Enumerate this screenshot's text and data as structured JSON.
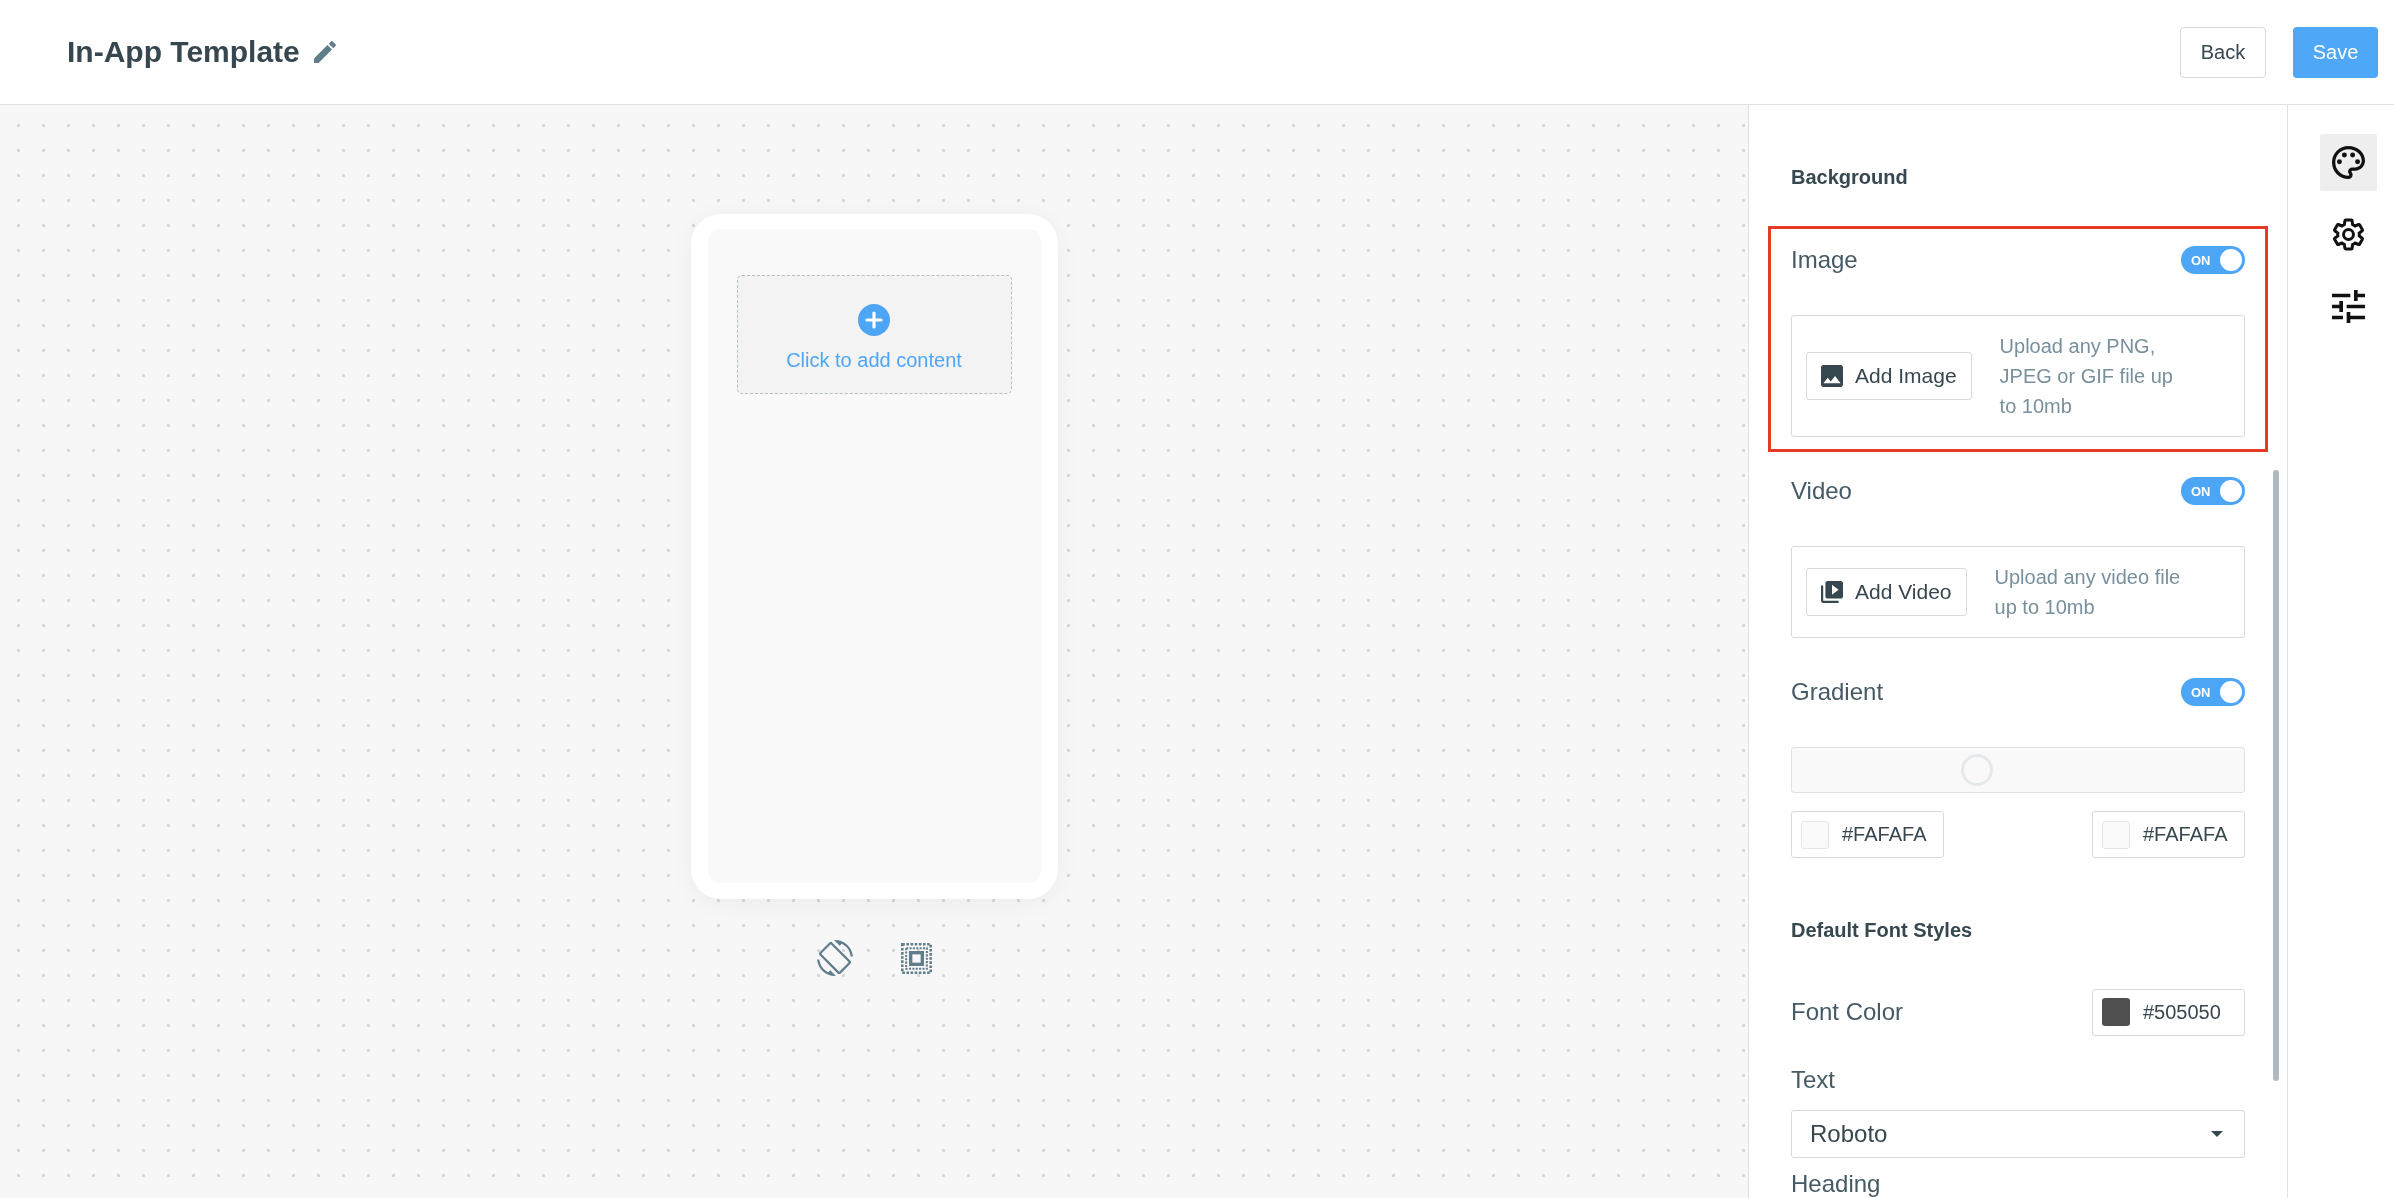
{
  "header": {
    "title": "In-App Template",
    "buttons": [
      {
        "label": "Back",
        "kind": "secondary"
      },
      {
        "label": "Save",
        "kind": "primary"
      }
    ]
  },
  "canvas": {
    "add_content": {
      "label": "Click to add content"
    },
    "tools": [
      {
        "kind": "rotate"
      },
      {
        "kind": "frame"
      }
    ]
  },
  "panel": {
    "background": {
      "heading": "Background",
      "rows": [
        {
          "kind": "image",
          "label": "Image",
          "toggle": "ON",
          "on": true,
          "highlighted": true,
          "button": "Add Image",
          "hint": "Upload any PNG, JPEG or GIF file up to 10mb"
        },
        {
          "kind": "video",
          "label": "Video",
          "toggle": "ON",
          "on": true,
          "highlighted": false,
          "button": "Add Video",
          "hint": "Upload any video file up to 10mb"
        },
        {
          "kind": "gradient",
          "label": "Gradient",
          "toggle": "ON",
          "on": true,
          "highlighted": false,
          "level": 0.41,
          "stops": [
            {
              "value": "#FAFAFA",
              "color": "#fafafa"
            },
            {
              "value": "#FAFAFA",
              "color": "#fafafa"
            }
          ]
        }
      ]
    },
    "font_styles": {
      "heading": "Default Font Styles",
      "font_color": {
        "label": "Font Color",
        "value": "#505050",
        "color": "#505050"
      },
      "text_font": {
        "label": "Text",
        "value": "Roboto"
      },
      "next_label": "Heading"
    }
  },
  "rail": {
    "items": [
      {
        "kind": "palette",
        "selected": true
      },
      {
        "kind": "settings",
        "selected": false
      },
      {
        "kind": "tune",
        "selected": false
      }
    ]
  }
}
